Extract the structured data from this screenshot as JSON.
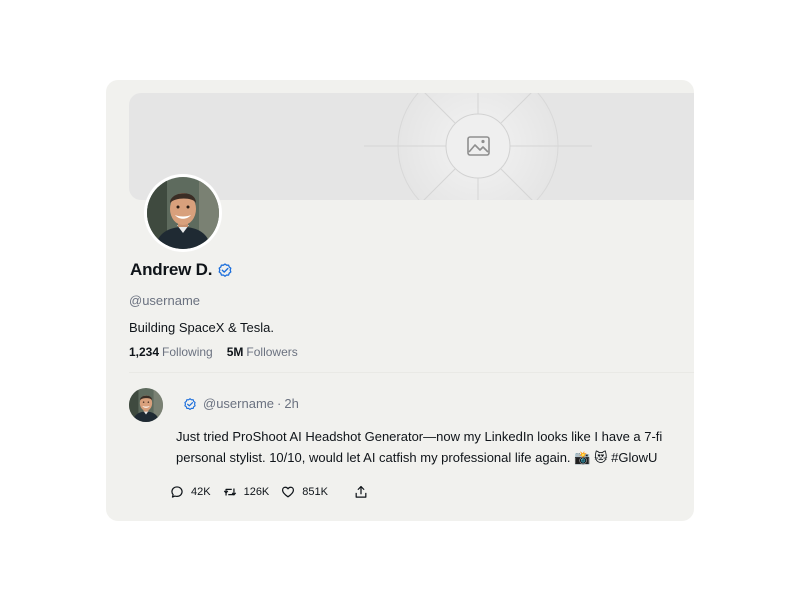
{
  "profile": {
    "name": "Andrew D.",
    "handle": "@username",
    "bio": "Building SpaceX & Tesla.",
    "following_count": "1,234",
    "following_label": "Following",
    "followers_count": "5M",
    "followers_label": "Followers"
  },
  "cover": {
    "icon": "image-placeholder-icon"
  },
  "tweet": {
    "handle": "@username",
    "separator": "·",
    "time": "2h",
    "line1": "Just tried ProShoot AI Headshot Generator—now my LinkedIn looks like I have a 7-fi",
    "line2": "personal stylist. 10/10, would let AI catfish my professional life again. 📸 😻 #GlowU",
    "replies": "42K",
    "retweets": "126K",
    "likes": "851K"
  },
  "colors": {
    "card_bg": "#f1f1ee",
    "cover_bg": "#e5e5e5",
    "verified": "#1d6fdc",
    "muted_text": "#6b7280"
  }
}
